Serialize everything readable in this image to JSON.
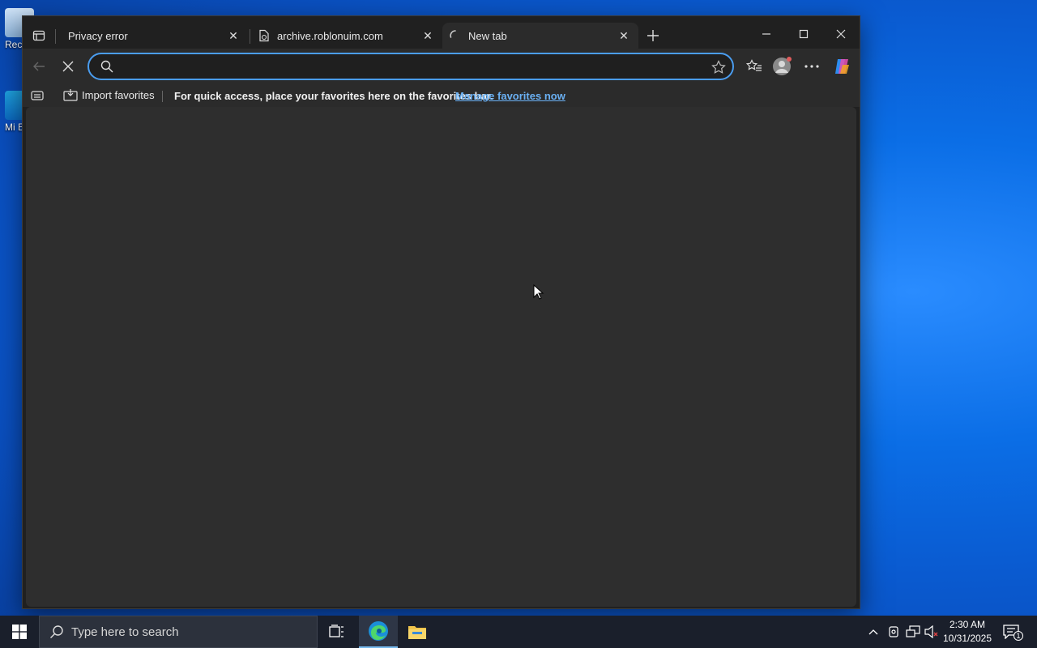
{
  "desktop": {
    "icons": [
      {
        "label": "Rec"
      },
      {
        "label": "Mi E"
      }
    ]
  },
  "browser": {
    "tabs": [
      {
        "title": "Privacy error",
        "state": "inactive"
      },
      {
        "title": "archive.roblonuim.com",
        "state": "inactive"
      },
      {
        "title": "New tab",
        "state": "active-loading"
      }
    ],
    "address_bar": {
      "value": "",
      "placeholder": ""
    },
    "favorites_bar": {
      "import_label": "Import favorites",
      "hint": "For quick access, place your favorites here on the favorites bar.",
      "manage_link": "Manage favorites now"
    }
  },
  "taskbar": {
    "search_placeholder": "Type here to search",
    "clock": {
      "time": "2:30 AM",
      "date": "10/31/2025"
    },
    "notification_count": "1"
  },
  "colors": {
    "accent": "#4a9df0",
    "link": "#6ab0f3",
    "window_bg": "#202020",
    "content_bg": "#2e2e2e"
  }
}
